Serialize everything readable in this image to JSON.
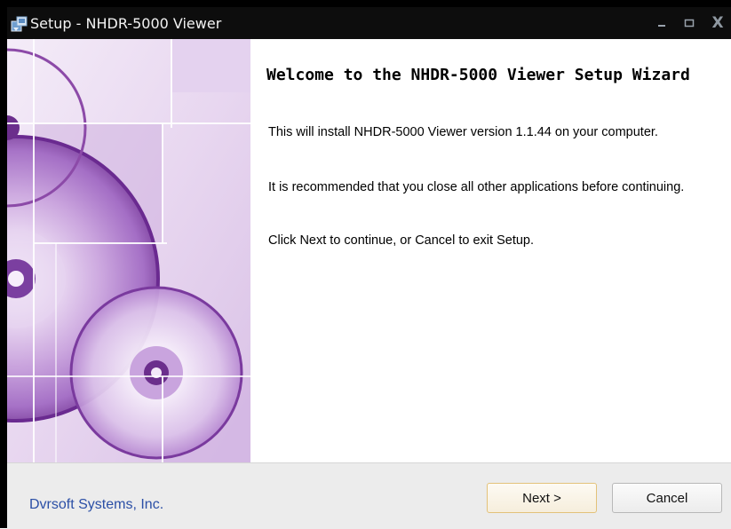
{
  "window": {
    "title": "Setup - NHDR-5000 Viewer",
    "app_icon": "installer-icon",
    "controls": {
      "minimize": "–",
      "maximize": "□",
      "close": "X"
    }
  },
  "banner": {
    "image": "purple-cd-discs-banner"
  },
  "content": {
    "title": "Welcome to the NHDR-5000 Viewer Setup Wizard",
    "paragraphs": [
      "This will install NHDR-5000 Viewer version 1.1.44 on your computer.",
      "It is recommended that you close all other applications before continuing.",
      "Click Next to continue, or Cancel to exit Setup."
    ]
  },
  "footer": {
    "company": "Dvrsoft Systems, Inc.",
    "next_label": "Next >",
    "cancel_label": "Cancel"
  },
  "colors": {
    "titlebar": "#0d0d0d",
    "company_text": "#2b4fa6",
    "next_border": "#e3c27a",
    "banner_accent": "#8c4aa8"
  }
}
